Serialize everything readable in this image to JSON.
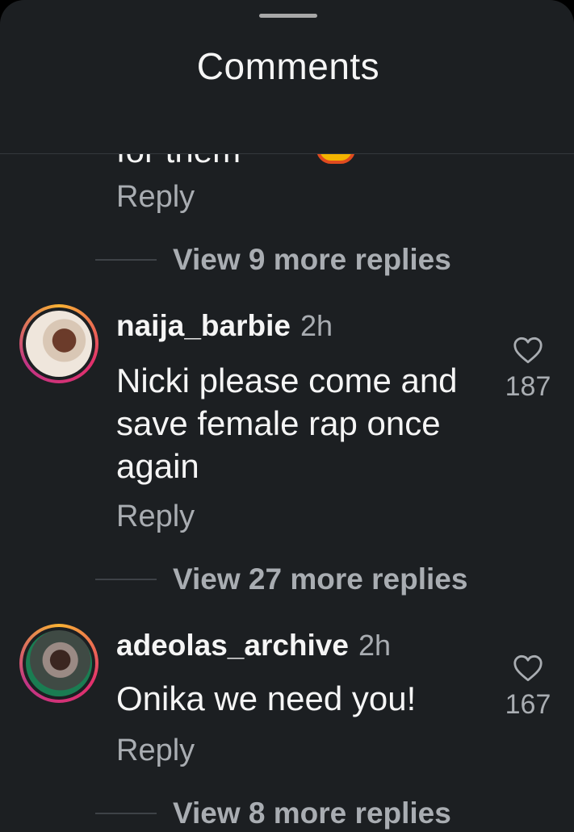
{
  "sheet": {
    "title": "Comments"
  },
  "partial_comment": {
    "text_fragment": "for them",
    "reply_label": "Reply",
    "view_more_label": "View 9 more replies"
  },
  "comments": [
    {
      "username": "naija_barbie",
      "time": "2h",
      "text": "Nicki please come and save female rap once again",
      "likes": "187",
      "reply_label": "Reply",
      "view_more_label": "View 27 more replies"
    },
    {
      "username": "adeolas_archive",
      "time": "2h",
      "text": "Onika we need you!",
      "likes": "167",
      "reply_label": "Reply",
      "view_more_label": "View 8 more replies"
    }
  ],
  "icons": {
    "like": "heart-outline-icon",
    "handle": "drag-handle"
  },
  "colors": {
    "background": "#1c1f22",
    "primary_text": "#f5f5f5",
    "secondary_text": "#a9adb2",
    "divider": "#34383d"
  }
}
